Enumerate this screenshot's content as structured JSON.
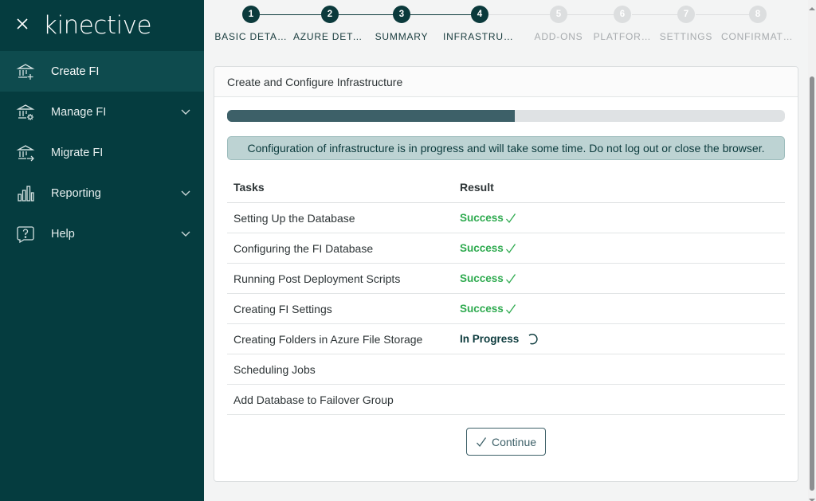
{
  "brand": {
    "name": "kinective"
  },
  "sidebar": {
    "items": [
      {
        "label": "Create FI",
        "icon": "bank-add-icon",
        "active": true,
        "expandable": false
      },
      {
        "label": "Manage FI",
        "icon": "bank-gear-icon",
        "active": false,
        "expandable": true
      },
      {
        "label": "Migrate FI",
        "icon": "bank-arrow-icon",
        "active": false,
        "expandable": false
      },
      {
        "label": "Reporting",
        "icon": "bar-chart-icon",
        "active": false,
        "expandable": true
      },
      {
        "label": "Help",
        "icon": "help-bubble-icon",
        "active": false,
        "expandable": true
      }
    ]
  },
  "stepper": {
    "steps": [
      {
        "number": "1",
        "label": "BASIC DETA…",
        "done": true
      },
      {
        "number": "2",
        "label": "AZURE DETA…",
        "done": true
      },
      {
        "number": "3",
        "label": "SUMMARY",
        "done": true
      },
      {
        "number": "4",
        "label": "INFRASTRUCT…",
        "done": true
      },
      {
        "number": "5",
        "label": "ADD-ONS",
        "done": false
      },
      {
        "number": "6",
        "label": "PLATFOR…",
        "done": false
      },
      {
        "number": "7",
        "label": "SETTINGS",
        "done": false
      },
      {
        "number": "8",
        "label": "CONFIRMATI…",
        "done": false
      }
    ]
  },
  "card": {
    "title": "Create and Configure Infrastructure",
    "progress_percent": 51.5,
    "alert": "Configuration of infrastructure is in progress and will take some time. Do not log out or close the browser.",
    "table": {
      "headers": {
        "task": "Tasks",
        "result": "Result"
      },
      "rows": [
        {
          "task": "Setting Up the Database",
          "result": "Success",
          "status": "success"
        },
        {
          "task": "Configuring the FI Database",
          "result": "Success",
          "status": "success"
        },
        {
          "task": "Running Post Deployment Scripts",
          "result": "Success",
          "status": "success"
        },
        {
          "task": "Creating FI Settings",
          "result": "Success",
          "status": "success"
        },
        {
          "task": "Creating Folders in Azure File Storage",
          "result": "In Progress",
          "status": "progress"
        },
        {
          "task": "Scheduling Jobs",
          "result": "",
          "status": "pending"
        },
        {
          "task": "Add Database to Failover Group",
          "result": "",
          "status": "pending"
        }
      ]
    },
    "continue_label": "Continue"
  },
  "colors": {
    "sidebar_bg": "#053c3f",
    "sidebar_active": "#0e4b4e",
    "accent": "#3d6068",
    "success": "#2eaa4f",
    "step_done": "#0b3a3c",
    "step_todo": "#dcdedf"
  }
}
